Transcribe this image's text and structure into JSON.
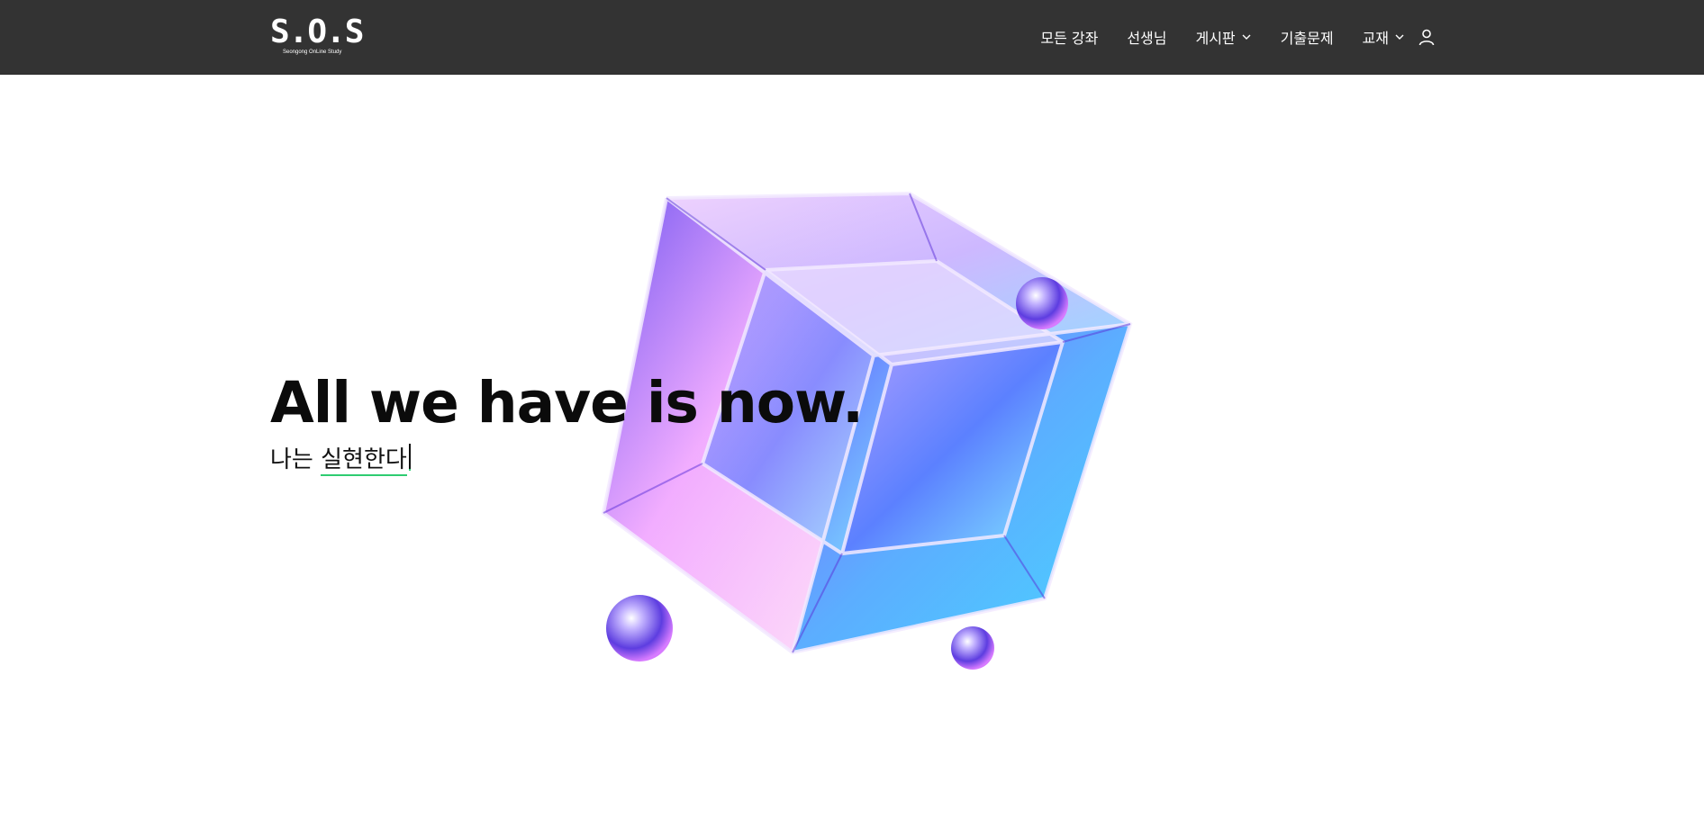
{
  "header": {
    "logo": {
      "text": "S.O.S",
      "subtitle": "Seongong OnLine Study"
    },
    "nav": [
      {
        "label": "모든 강좌",
        "has_dropdown": false
      },
      {
        "label": "선생님",
        "has_dropdown": false
      },
      {
        "label": "게시판",
        "has_dropdown": true
      },
      {
        "label": "기출문제",
        "has_dropdown": false
      },
      {
        "label": "교재",
        "has_dropdown": true
      }
    ],
    "user_icon": "user-icon"
  },
  "hero": {
    "title": "All we have is now.",
    "subtitle_prefix": "나는 ",
    "subtitle_typed": "실현한다",
    "image": "glass-cube-image"
  },
  "colors": {
    "header_bg": "#333333",
    "page_bg": "#ffffff",
    "title_text": "#0b0b0b",
    "typed_underline": "#2ecc71"
  }
}
